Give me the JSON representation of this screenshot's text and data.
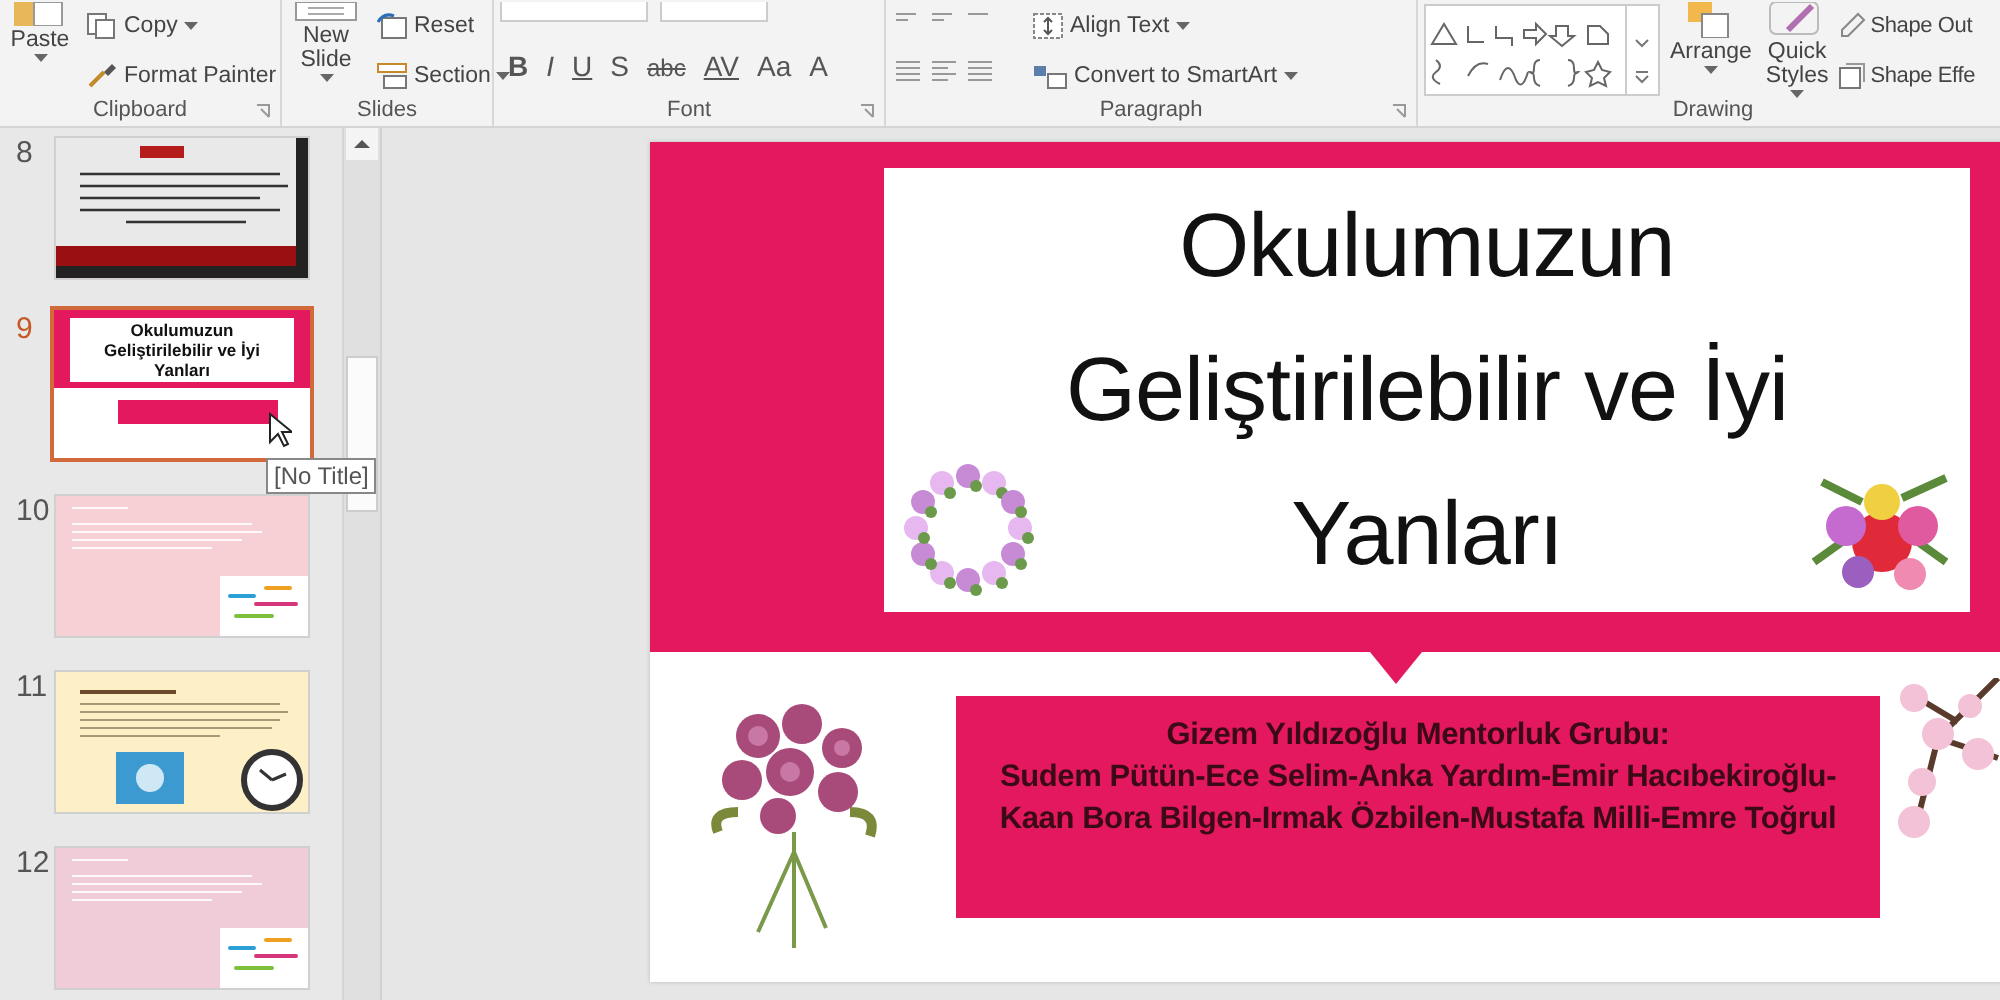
{
  "ribbon": {
    "groups": [
      {
        "label": "Clipboard",
        "columns": [
          [
            {
              "kind": "large",
              "label": "Paste",
              "caret": true
            }
          ],
          [
            {
              "kind": "small",
              "label": "Copy",
              "caret": true
            },
            {
              "kind": "small",
              "label": "Format Painter",
              "caret": false
            }
          ]
        ]
      },
      {
        "label": "Slides",
        "columns": [
          [
            {
              "kind": "large",
              "label": "New Slide",
              "caret": true
            }
          ],
          [
            {
              "kind": "small",
              "label": "Reset",
              "caret": false
            },
            {
              "kind": "small",
              "label": "Section",
              "caret": true
            }
          ]
        ]
      },
      {
        "label": "Font",
        "columns": [
          [
            {
              "kind": "glyphs",
              "glyphs": [
                "B",
                "I",
                "U",
                "S",
                "abc",
                "AV",
                "Aa",
                "A"
              ]
            }
          ]
        ]
      },
      {
        "label": "Paragraph",
        "columns": [
          [
            {
              "kind": "align-icons"
            }
          ],
          [
            {
              "kind": "small",
              "label": "Align Text",
              "caret": true
            },
            {
              "kind": "small",
              "label": "Convert to SmartArt",
              "caret": true
            }
          ]
        ]
      },
      {
        "label": "Drawing",
        "columns": [
          [
            {
              "kind": "shape-gallery"
            }
          ],
          [
            {
              "kind": "large",
              "label": "Arrange",
              "caret": true
            }
          ],
          [
            {
              "kind": "large",
              "label": "Quick Styles",
              "caret": true
            }
          ],
          [
            {
              "kind": "small",
              "label": "Shape Out",
              "caret": false
            },
            {
              "kind": "small",
              "label": "Shape Effe",
              "caret": false
            }
          ]
        ]
      }
    ]
  },
  "slides_panel": {
    "slides": [
      {
        "number": "8",
        "selected": false,
        "kind": "dark",
        "color": "#e9e9e9"
      },
      {
        "number": "9",
        "selected": true,
        "kind": "title",
        "color": "#e4185f",
        "title_lines": [
          "Okulumuzun",
          "Geliştirilebilir ve İyi",
          "Yanları"
        ]
      },
      {
        "number": "10",
        "selected": false,
        "kind": "text-image",
        "color": "#f6d0d4"
      },
      {
        "number": "11",
        "selected": false,
        "kind": "text-two-images",
        "color": "#fdf0c6"
      },
      {
        "number": "12",
        "selected": false,
        "kind": "text-image",
        "color": "#f0cbd8"
      }
    ],
    "tooltip": "[No Title]"
  },
  "slide": {
    "title_lines": [
      "Okulumuzun",
      "Geliştirilebilir ve İyi",
      "Yanları"
    ],
    "subtitle_lines": [
      "Gizem Yıldızoğlu Mentorluk Grubu:",
      "Sudem Pütün-Ece Selim-Anka Yardım-Emir Hacıbekiroğlu-",
      "Kaan Bora Bilgen-Irmak Özbilen-Mustafa Milli-Emre Toğrul"
    ]
  }
}
